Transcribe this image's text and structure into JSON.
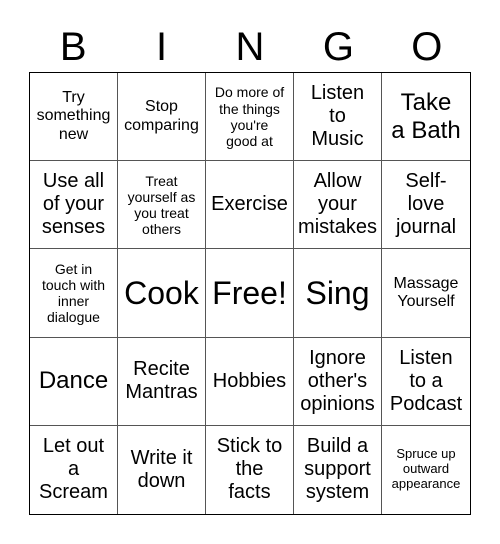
{
  "header": {
    "letters": [
      "B",
      "I",
      "N",
      "G",
      "O"
    ]
  },
  "cells": [
    {
      "text": "Try\nsomething\nnew"
    },
    {
      "text": "Stop\ncomparing"
    },
    {
      "text": "Do more of\nthe things\nyou're\ngood at"
    },
    {
      "text": "Listen\nto\nMusic"
    },
    {
      "text": "Take\na Bath"
    },
    {
      "text": "Use all\nof your\nsenses"
    },
    {
      "text": "Treat\nyourself as\nyou treat\nothers"
    },
    {
      "text": "Exercise"
    },
    {
      "text": "Allow\nyour\nmistakes"
    },
    {
      "text": "Self-\nlove\njournal"
    },
    {
      "text": "Get in\ntouch with\ninner\ndialogue"
    },
    {
      "text": "Cook"
    },
    {
      "text": "Free!"
    },
    {
      "text": "Sing"
    },
    {
      "text": "Massage\nYourself"
    },
    {
      "text": "Dance"
    },
    {
      "text": "Recite\nMantras"
    },
    {
      "text": "Hobbies"
    },
    {
      "text": "Ignore\nother's\nopinions"
    },
    {
      "text": "Listen\nto a\nPodcast"
    },
    {
      "text": "Let out\na\nScream"
    },
    {
      "text": "Write it\ndown"
    },
    {
      "text": "Stick to\nthe\nfacts"
    },
    {
      "text": "Build a\nsupport\nsystem"
    },
    {
      "text": "Spruce up\noutward\nappearance"
    }
  ]
}
